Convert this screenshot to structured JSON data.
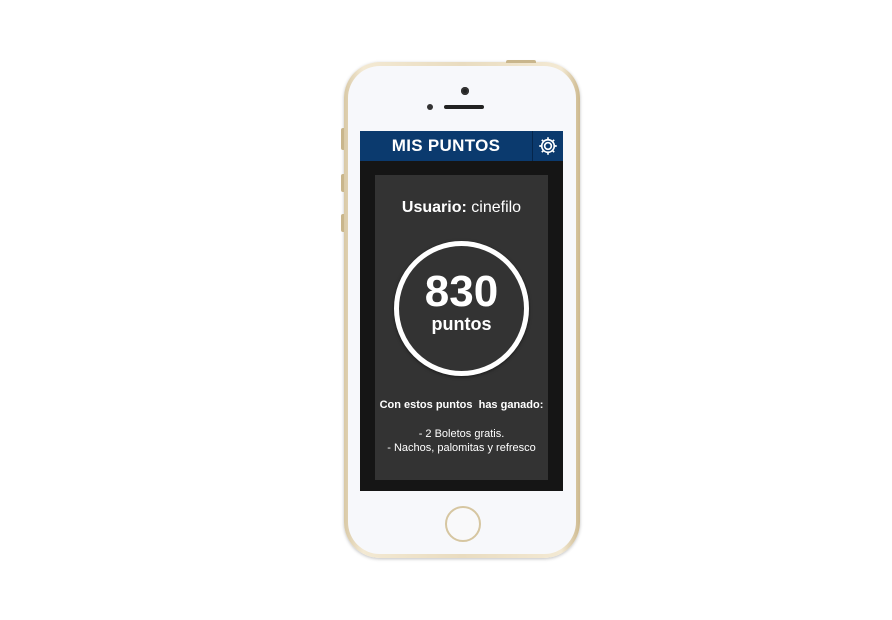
{
  "header": {
    "title": "MIS PUNTOS",
    "settings_icon": "gear-icon"
  },
  "user": {
    "label": "Usuario:",
    "name": "cinefilo"
  },
  "points": {
    "value": "830",
    "unit": "puntos"
  },
  "rewards": {
    "heading": "Con estos puntos  has ganado:",
    "items": [
      "- 2 Boletos gratis.",
      "- Nachos, palomitas y refresco"
    ]
  },
  "colors": {
    "header_bg": "#0b3a6e",
    "card_bg": "#333333",
    "screen_bg": "#151515",
    "phone_frame": "#e9dcc0"
  }
}
